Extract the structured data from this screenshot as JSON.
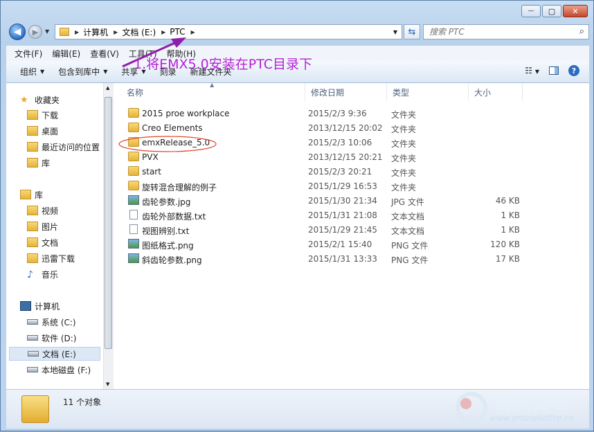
{
  "window": {
    "minimize": "—",
    "maximize": "▢",
    "close": "✕"
  },
  "address": {
    "segments": [
      "计算机",
      "文档 (E:)",
      "PTC"
    ]
  },
  "search": {
    "placeholder": "搜索 PTC"
  },
  "menu": [
    "文件(F)",
    "编辑(E)",
    "查看(V)",
    "工具(T)",
    "帮助(H)"
  ],
  "toolbar": {
    "organize": "组织",
    "include": "包含到库中",
    "share": "共享",
    "burn": "刻录",
    "new_folder": "新建文件夹"
  },
  "nav": [
    {
      "label": "收藏夹",
      "icon": "star-icon"
    },
    {
      "label": "下载",
      "icon": "downloads-folder-icon"
    },
    {
      "label": "桌面",
      "icon": "desktop-icon"
    },
    {
      "label": "最近访问的位置",
      "icon": "recent-places-icon"
    },
    {
      "label": "库",
      "icon": "library-icon"
    },
    {
      "label": "库",
      "icon": "library-icon"
    },
    {
      "label": "视频",
      "icon": "video-icon"
    },
    {
      "label": "图片",
      "icon": "pictures-icon"
    },
    {
      "label": "文档",
      "icon": "documents-icon"
    },
    {
      "label": "迅雷下载",
      "icon": "thunder-download-icon"
    },
    {
      "label": "音乐",
      "icon": "music-icon"
    },
    {
      "label": "计算机",
      "icon": "computer-icon"
    },
    {
      "label": "系统 (C:)",
      "icon": "system-drive-icon"
    },
    {
      "label": "软件 (D:)",
      "icon": "drive-icon"
    },
    {
      "label": "文档 (E:)",
      "icon": "drive-icon"
    },
    {
      "label": "本地磁盘 (F:)",
      "icon": "drive-icon"
    }
  ],
  "columns": {
    "name": "名称",
    "date": "修改日期",
    "type": "类型",
    "size": "大小"
  },
  "files": [
    {
      "name": "2015 proe workplace",
      "date": "2015/2/3 9:36",
      "type": "文件夹",
      "size": "",
      "icon": "folder"
    },
    {
      "name": "Creo Elements",
      "date": "2013/12/15 20:02",
      "type": "文件夹",
      "size": "",
      "icon": "folder"
    },
    {
      "name": "emxRelease_5.0",
      "date": "2015/2/3 10:06",
      "type": "文件夹",
      "size": "",
      "icon": "folder"
    },
    {
      "name": "PVX",
      "date": "2013/12/15 20:21",
      "type": "文件夹",
      "size": "",
      "icon": "folder"
    },
    {
      "name": "start",
      "date": "2015/2/3 20:21",
      "type": "文件夹",
      "size": "",
      "icon": "folder"
    },
    {
      "name": "旋转混合理解的例子",
      "date": "2015/1/29 16:53",
      "type": "文件夹",
      "size": "",
      "icon": "folder"
    },
    {
      "name": "齿轮参数.jpg",
      "date": "2015/1/30 21:34",
      "type": "JPG 文件",
      "size": "46 KB",
      "icon": "img"
    },
    {
      "name": "齿轮外部数据.txt",
      "date": "2015/1/31 21:08",
      "type": "文本文档",
      "size": "1 KB",
      "icon": "doc"
    },
    {
      "name": "视图辨别.txt",
      "date": "2015/1/29 21:45",
      "type": "文本文档",
      "size": "1 KB",
      "icon": "doc"
    },
    {
      "name": "图纸格式.png",
      "date": "2015/2/1 15:40",
      "type": "PNG 文件",
      "size": "120 KB",
      "icon": "img"
    },
    {
      "name": "斜齿轮参数.png",
      "date": "2015/1/31 13:33",
      "type": "PNG 文件",
      "size": "17 KB",
      "icon": "img"
    }
  ],
  "status": {
    "count": "11 个对象"
  },
  "annotation": {
    "text": "1.将EMX5.0安装在PTC目录下",
    "color": "#b620d6"
  },
  "watermark": {
    "cn": "野火论坛",
    "url": "www.proewildfire.cn"
  }
}
